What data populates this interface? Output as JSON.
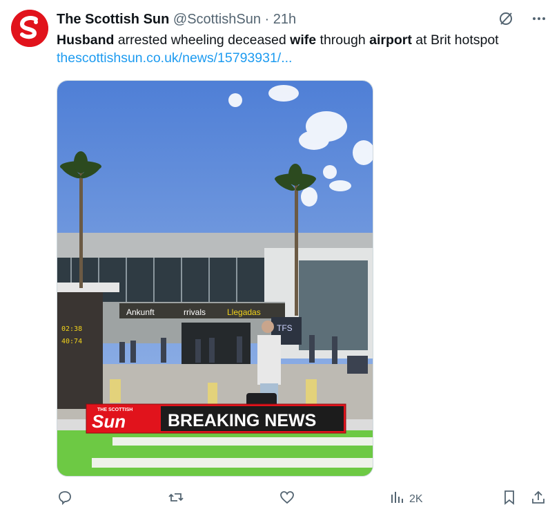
{
  "tweet": {
    "author_name": "The Scottish Sun",
    "author_handle": "@ScottishSun",
    "separator": "·",
    "time": "21h",
    "text_parts": [
      {
        "t": "Husband",
        "bold": true
      },
      {
        "t": " arrested wheeling deceased ",
        "bold": false
      },
      {
        "t": "wife",
        "bold": true
      },
      {
        "t": " through ",
        "bold": false
      },
      {
        "t": "airport",
        "bold": true
      },
      {
        "t": " at Brit hotspot",
        "bold": false
      }
    ],
    "link": "thescottishsun.co.uk/news/15793931/...",
    "image": {
      "sign_ankunft": "Ankunft",
      "sign_arrivals": "rrivals",
      "sign_llegadas": "Llegadas",
      "sign_tfs": "TFS",
      "board_time": "02:38",
      "board_gate": "40:74",
      "banner_brand_top": "THE SCOTTISH",
      "banner_brand": "Sun",
      "banner_text": "BREAKING NEWS"
    },
    "views": "2K"
  },
  "icons": {
    "grok": "grok-icon",
    "more": "more-icon",
    "reply": "reply-icon",
    "retweet": "retweet-icon",
    "like": "like-icon",
    "views": "views-icon",
    "bookmark": "bookmark-icon",
    "share": "share-icon"
  },
  "colors": {
    "brand_red": "#e1131c",
    "link": "#1d9bf0",
    "muted": "#536471"
  }
}
